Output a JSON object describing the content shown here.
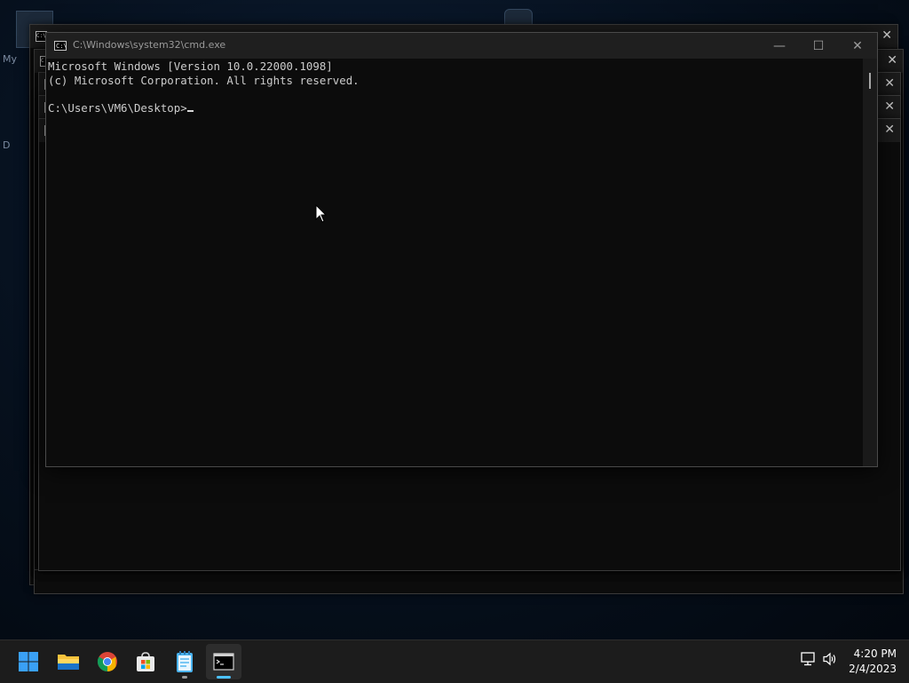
{
  "desktop": {
    "label_fragments": [
      "My",
      "D"
    ]
  },
  "cmd_window": {
    "title": "C:\\Windows\\system32\\cmd.exe",
    "icon_text": "C:\\",
    "minimize_glyph": "—",
    "maximize_glyph": "☐",
    "close_glyph": "✕",
    "lines": [
      "Microsoft Windows [Version 10.0.22000.1098]",
      "(c) Microsoft Corporation. All rights reserved.",
      "",
      "C:\\Users\\VM6\\Desktop>"
    ]
  },
  "background_windows": {
    "close_glyph": "✕",
    "icon_text": "C:\\"
  },
  "taskbar": {
    "apps": [
      {
        "name": "Start",
        "icon": "windows-logo-icon"
      },
      {
        "name": "File Explorer",
        "icon": "folder-icon"
      },
      {
        "name": "Google Chrome",
        "icon": "chrome-icon"
      },
      {
        "name": "Microsoft Store",
        "icon": "store-icon"
      },
      {
        "name": "Notepad",
        "icon": "notepad-icon"
      },
      {
        "name": "Command Prompt",
        "icon": "terminal-icon"
      }
    ],
    "tray": {
      "network_icon": "network-icon",
      "volume_icon": "volume-icon"
    },
    "clock": {
      "time": "4:20 PM",
      "date": "2/4/2023"
    }
  },
  "colors": {
    "console_bg": "#0c0c0c",
    "console_text": "#cccccc",
    "taskbar_bg": "#1c1c1c",
    "accent": "#4cc2ff"
  }
}
